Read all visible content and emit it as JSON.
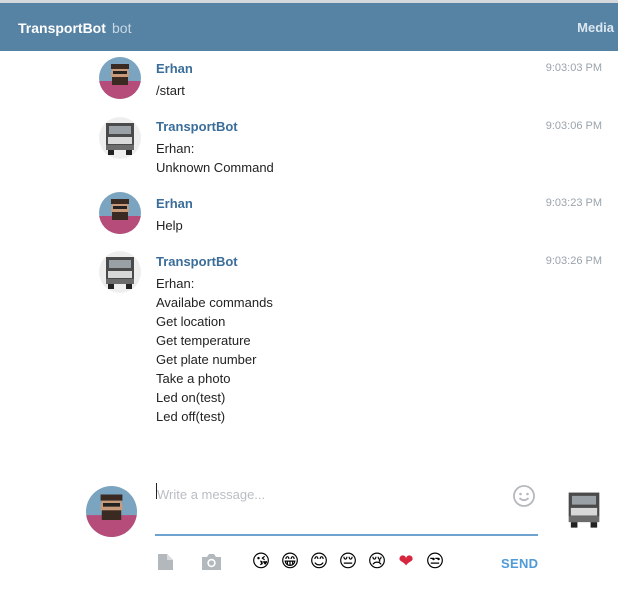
{
  "header": {
    "title": "TransportBot",
    "subtitle": "bot",
    "media_label": "Media"
  },
  "messages": [
    {
      "sender": "Erhan",
      "time": "9:03:03 PM",
      "lines": [
        "/start"
      ]
    },
    {
      "sender": "TransportBot",
      "time": "9:03:06 PM",
      "lines": [
        "Erhan:",
        "Unknown Command"
      ]
    },
    {
      "sender": "Erhan",
      "time": "9:03:23 PM",
      "lines": [
        "Help"
      ]
    },
    {
      "sender": "TransportBot",
      "time": "9:03:26 PM",
      "lines": [
        "Erhan:",
        "Availabe commands",
        "Get location",
        "Get temperature",
        "Get plate number",
        "Take a photo",
        "Led on(test)",
        "Led off(test)"
      ]
    }
  ],
  "composer": {
    "placeholder": "Write a message...",
    "send_label": "SEND",
    "emojis": [
      "😘",
      "😁",
      "😊",
      "😔",
      "😢",
      "❤",
      "😒"
    ]
  },
  "colors": {
    "header_bg": "#5682a3",
    "sender_name": "#3a6d99",
    "send_button": "#4f9ad7",
    "input_underline": "#6ea3d0"
  }
}
